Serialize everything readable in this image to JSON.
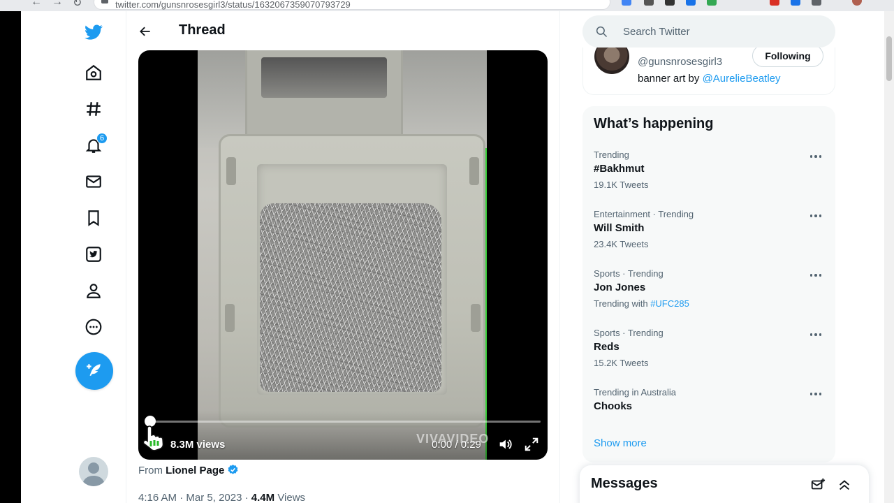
{
  "browser": {
    "url": "twitter.com/gunsnrosesgirl3/status/1632067359070793729"
  },
  "nav": {
    "notifications_badge": "6"
  },
  "header": {
    "title": "Thread"
  },
  "video": {
    "views": "8.3M views",
    "watermark": "VIVAVIDEO",
    "time": "0:00 / 0:29",
    "progress": 0.0
  },
  "tweet": {
    "source_prefix": "From",
    "source_name": "Lionel Page",
    "time": "4:16 AM",
    "date": "Mar 5, 2023",
    "separator": "·",
    "views_count": "4.4M",
    "views_label": "Views"
  },
  "search": {
    "placeholder": "Search Twitter"
  },
  "who_card": {
    "handle": "@gunsnrosesgirl3",
    "bio_prefix": "banner art by",
    "bio_link": "@AurelieBeatley",
    "follow_label": "Following"
  },
  "happening": {
    "title": "What’s happening",
    "trends": [
      {
        "context": "Trending",
        "name": "#Bakhmut",
        "count": "19.1K Tweets",
        "link": ""
      },
      {
        "context": "Entertainment · Trending",
        "name": "Will Smith",
        "count": "23.4K Tweets",
        "link": ""
      },
      {
        "context": "Sports · Trending",
        "name": "Jon Jones",
        "count": "Trending with",
        "link": "#UFC285"
      },
      {
        "context": "Sports · Trending",
        "name": "Reds",
        "count": "15.2K Tweets",
        "link": ""
      },
      {
        "context": "Trending in Australia",
        "name": "Chooks",
        "count": "",
        "link": ""
      }
    ],
    "show_more": "Show more"
  },
  "messages": {
    "title": "Messages"
  },
  "colors": {
    "accent": "#1d9bf0",
    "text": "#0f1419",
    "secondary": "#536471"
  }
}
